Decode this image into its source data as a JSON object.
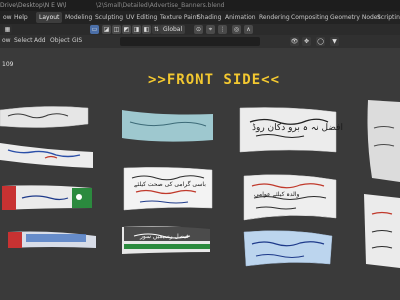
{
  "titlebar": {
    "left_text": "Drive\\Desktop\\N E W\\l",
    "path_text": "\\2\\Small\\Detailed\\Advertise_Banners.blend"
  },
  "menu": [
    "ow",
    "Help"
  ],
  "workspaces": [
    {
      "label": "Layout",
      "active": true
    },
    {
      "label": "Modeling",
      "active": false
    },
    {
      "label": "Sculpting",
      "active": false
    },
    {
      "label": "UV Editing",
      "active": false
    },
    {
      "label": "Texture Paint",
      "active": false
    },
    {
      "label": "Shading",
      "active": false
    },
    {
      "label": "Animation",
      "active": false
    },
    {
      "label": "Rendering",
      "active": false
    },
    {
      "label": "Compositing",
      "active": false
    },
    {
      "label": "Geometry Nodes",
      "active": false
    },
    {
      "label": "Scripting",
      "active": false
    }
  ],
  "header": {
    "view": "ow",
    "select": "Select",
    "add": "Add",
    "object": "Object",
    "gis": "GIS",
    "orientation": "Global"
  },
  "viewport": {
    "collection_info": "109",
    "title": ">>FRONT SIDE<<"
  },
  "banners": {
    "b1_text": "",
    "b2_text": "افضل نہ ہ برو دکان روڈ",
    "b3_text": "باسی گرامی کی صحت کیلئے",
    "b4_text": "فیصل رسیمیں سور",
    "b5_text": "والدہ کیلئے عوامی"
  }
}
